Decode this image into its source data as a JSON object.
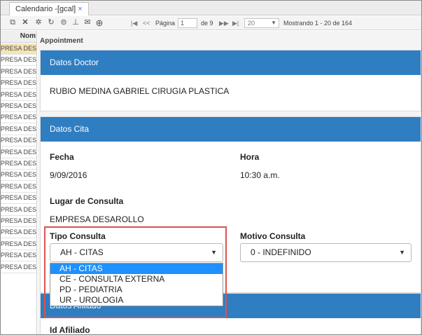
{
  "tab": {
    "title": "Calendario -[gcal]",
    "close": "×"
  },
  "toolbar": {
    "icons": [
      "open-icon",
      "delete-icon",
      "settings-icon",
      "refresh-icon",
      "filter-icon",
      "pin-icon",
      "mail-icon",
      "add-circle-icon"
    ],
    "first_glyph": "|◀",
    "prev_glyph": "<<",
    "page_label": "Página",
    "page_value": "1",
    "page_of": "de 9",
    "next_glyph": "▶▶",
    "last_glyph": "▶|",
    "page_size": "20",
    "showing": "Mostrando 1 - 20 de 164"
  },
  "grid": {
    "header": "Nom",
    "rows": [
      "PRESA DESA",
      "PRESA DESA",
      "PRESA DESA",
      "PRESA DESA",
      "PRESA DESA",
      "PRESA DESA",
      "PRESA DESA",
      "PRESA DESA",
      "PRESA DESA",
      "PRESA DESA",
      "PRESA DESA",
      "PRESA DESA",
      "PRESA DESA",
      "PRESA DESA",
      "PRESA DESA",
      "PRESA DESA",
      "PRESA DESA",
      "PRESA DESA",
      "PRESA DESA",
      "PRESA DESA"
    ],
    "selected_index": 0
  },
  "appointment": {
    "title": "Appointment",
    "doctor": {
      "header": "Datos Doctor",
      "name": "RUBIO MEDINA GABRIEL CIRUGIA PLASTICA"
    },
    "cita": {
      "header": "Datos Cita",
      "fecha_label": "Fecha",
      "fecha_value": "9/09/2016",
      "hora_label": "Hora",
      "hora_value": "10:30 a.m.",
      "lugar_label": "Lugar de Consulta",
      "lugar_value": "EMPRESA DESAROLLO",
      "tipo_label": "Tipo Consulta",
      "tipo_value": "AH - CITAS",
      "tipo_options": [
        "AH - CITAS",
        "CE - CONSULTA EXTERNA",
        "PD - PEDIATRIA",
        "UR - UROLOGIA"
      ],
      "motivo_label": "Motivo Consulta",
      "motivo_value": "0 - INDEFINIDO"
    },
    "afiliado": {
      "header": "Datos Afiliado",
      "id_label": "Id Afiliado"
    }
  },
  "colors": {
    "header_blue": "#2f7ec1",
    "highlight": "#1e90ff",
    "callout_red": "#d9534f",
    "row_selected": "#f5e4b5"
  }
}
